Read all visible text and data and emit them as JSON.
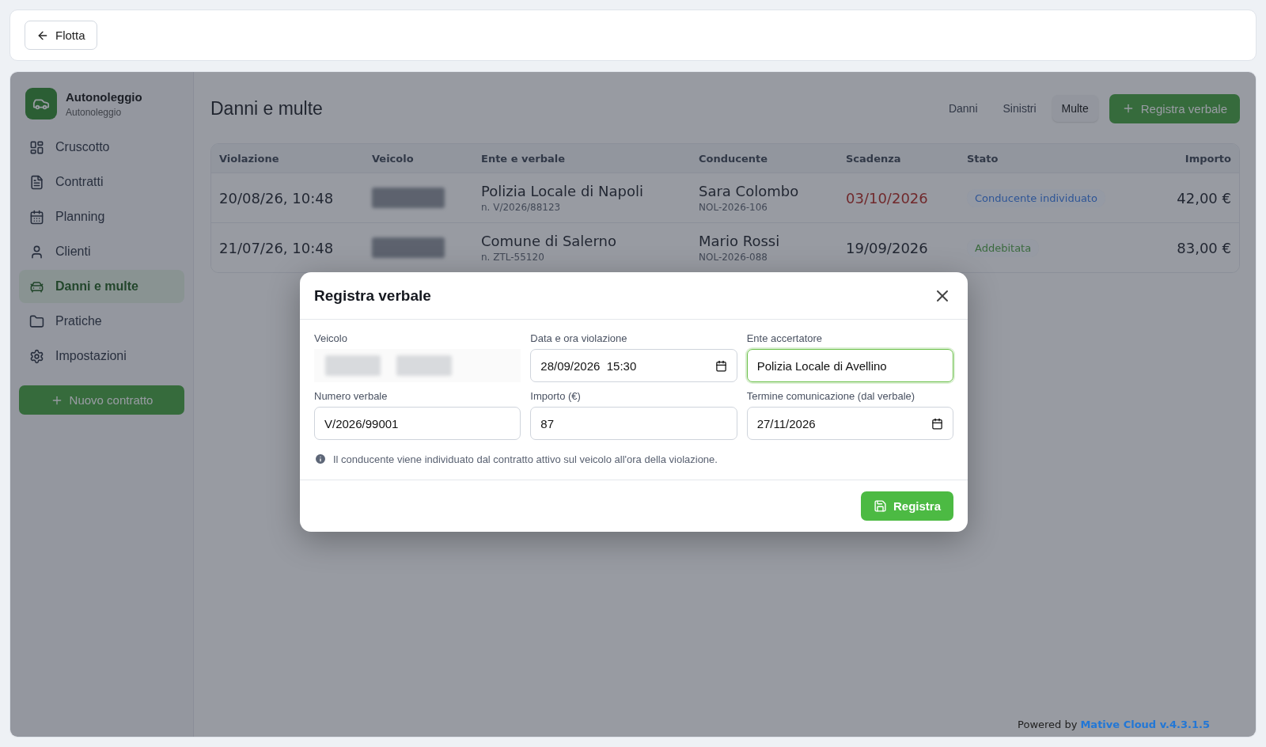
{
  "header": {
    "back_button": "Flotta"
  },
  "sidebar": {
    "brand": {
      "title": "Autonoleggio",
      "subtitle": "Autonoleggio"
    },
    "items": [
      {
        "label": "Cruscotto",
        "selected": false
      },
      {
        "label": "Contratti",
        "selected": false
      },
      {
        "label": "Planning",
        "selected": false
      },
      {
        "label": "Clienti",
        "selected": false
      },
      {
        "label": "Danni e multe",
        "selected": true
      },
      {
        "label": "Pratiche",
        "selected": false
      },
      {
        "label": "Impostazioni",
        "selected": false
      }
    ],
    "new_button": "Nuovo contratto"
  },
  "page": {
    "title": "Danni e multe",
    "tabs": [
      {
        "label": "Danni",
        "selected": false
      },
      {
        "label": "Sinistri",
        "selected": false
      },
      {
        "label": "Multe",
        "selected": true
      }
    ],
    "action_button": "Registra verbale"
  },
  "table": {
    "columns": [
      "Violazione",
      "Veicolo",
      "Ente e verbale",
      "Conducente",
      "Scadenza",
      "Stato",
      "Importo"
    ],
    "rows": [
      {
        "violation": "20/08/26, 10:48",
        "vehicle_redacted": true,
        "authority": "Polizia Locale di Napoli",
        "ticket": "n. V/2026/88123",
        "driver": "Sara Colombo",
        "contract": "NOL-2026-106",
        "due": "03/10/2026",
        "overdue": true,
        "status": "Conducente individuato",
        "color": "#2e5596",
        "amount": "42,00 €"
      },
      {
        "violation": "21/07/26, 10:48",
        "vehicle_redacted": true,
        "authority": "Comune di Salerno",
        "ticket": "n. ZTL-55120",
        "driver": "Mario Rossi",
        "contract": "NOL-2026-088",
        "due": "19/09/2026",
        "overdue": false,
        "status": "Addebitata",
        "color": "#3a6a3e",
        "amount": "83,00 €"
      }
    ]
  },
  "dialog": {
    "title": "Registra verbale",
    "fields": [
      {
        "label": "Veicolo",
        "kind": "redacted"
      },
      {
        "label": "Data e ora violazione",
        "kind": "date",
        "value": "28/09/2026  15:30",
        "focused": false
      },
      {
        "label": "Ente accertatore",
        "kind": "text",
        "value": "Polizia Locale di Avellino",
        "focused": true
      },
      {
        "label": "Numero verbale",
        "kind": "text",
        "value": "V/2026/99001",
        "focused": false
      },
      {
        "label": "Importo (€)",
        "kind": "text",
        "value": "87",
        "focused": false
      },
      {
        "label": "Termine comunicazione (dal verbale)",
        "kind": "date",
        "value": "27/11/2026",
        "focused": false
      }
    ],
    "note": "Il conducente viene individuato dal contratto attivo sul veicolo all'ora della violazione.",
    "submit_button": "Registra"
  },
  "footer": {
    "prefix": "Powered by",
    "link": "Mative Cloud v.4.3.1.5"
  }
}
